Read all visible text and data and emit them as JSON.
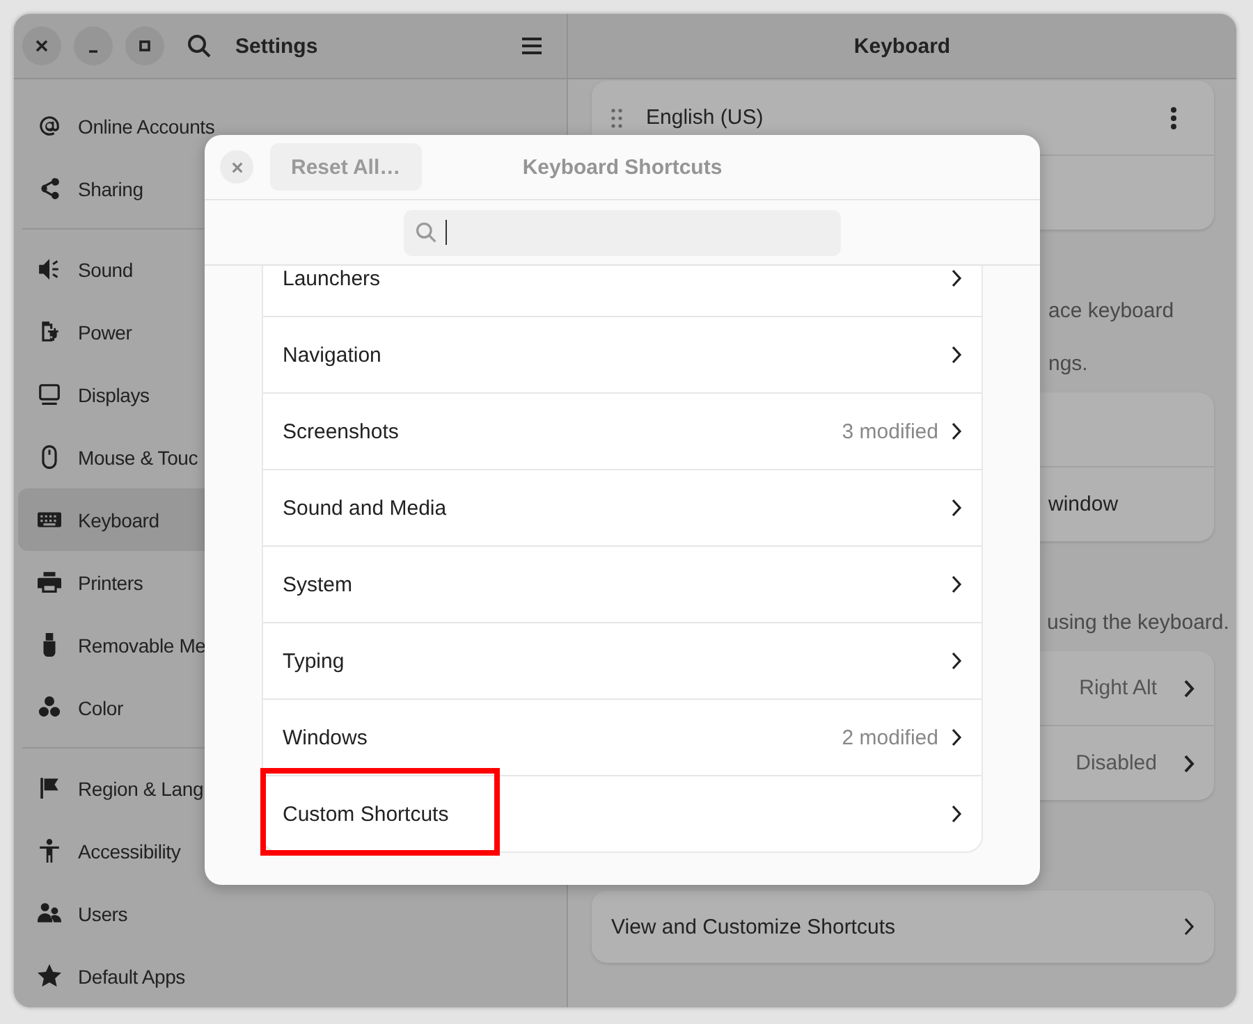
{
  "window": {
    "title": "Settings"
  },
  "sidebar": {
    "groups": [
      {
        "items": [
          {
            "label": "Online Accounts",
            "selected": false
          },
          {
            "label": "Sharing",
            "selected": false
          }
        ]
      },
      {
        "items": [
          {
            "label": "Sound",
            "selected": false
          },
          {
            "label": "Power",
            "selected": false
          },
          {
            "label": "Displays",
            "selected": false
          },
          {
            "label": "Mouse & Touc",
            "selected": false
          },
          {
            "label": "Keyboard",
            "selected": true
          },
          {
            "label": "Printers",
            "selected": false
          },
          {
            "label": "Removable Me",
            "selected": false
          },
          {
            "label": "Color",
            "selected": false
          }
        ]
      },
      {
        "items": [
          {
            "label": "Region & Lang",
            "selected": false
          },
          {
            "label": "Accessibility",
            "selected": false
          },
          {
            "label": "Users",
            "selected": false
          },
          {
            "label": "Default Apps",
            "selected": false
          }
        ]
      }
    ]
  },
  "panel": {
    "title": "Keyboard",
    "sections": [
      {
        "kind": "card",
        "rows": [
          {
            "kind": "layout",
            "label": "English (US)"
          },
          {
            "kind": "blank"
          }
        ]
      },
      {
        "kind": "note",
        "lines": [
          "ace keyboard",
          "ngs."
        ]
      },
      {
        "kind": "card",
        "rows": [
          {
            "kind": "blank"
          },
          {
            "kind": "cut",
            "label": "window"
          }
        ]
      },
      {
        "kind": "note",
        "lines": [
          "using the keyboard."
        ]
      },
      {
        "kind": "card",
        "rows": [
          {
            "kind": "value",
            "value": "Right Alt"
          },
          {
            "kind": "value",
            "value": "Disabled"
          }
        ]
      },
      {
        "kind": "card",
        "rows": [
          {
            "kind": "link",
            "label": "View and Customize Shortcuts"
          }
        ]
      }
    ]
  },
  "dialog": {
    "title": "Keyboard Shortcuts",
    "reset": {
      "label": "Reset All…",
      "disabled": true
    },
    "items": [
      {
        "label": "Launchers",
        "highlighted": false
      },
      {
        "label": "Navigation",
        "highlighted": false
      },
      {
        "label": "Screenshots",
        "value": "3 modified",
        "highlighted": false
      },
      {
        "label": "Sound and Media",
        "highlighted": false
      },
      {
        "label": "System",
        "highlighted": false
      },
      {
        "label": "Typing",
        "highlighted": false
      },
      {
        "label": "Windows",
        "value": "2 modified",
        "highlighted": false
      },
      {
        "label": "Custom Shortcuts",
        "highlighted": true
      }
    ]
  }
}
